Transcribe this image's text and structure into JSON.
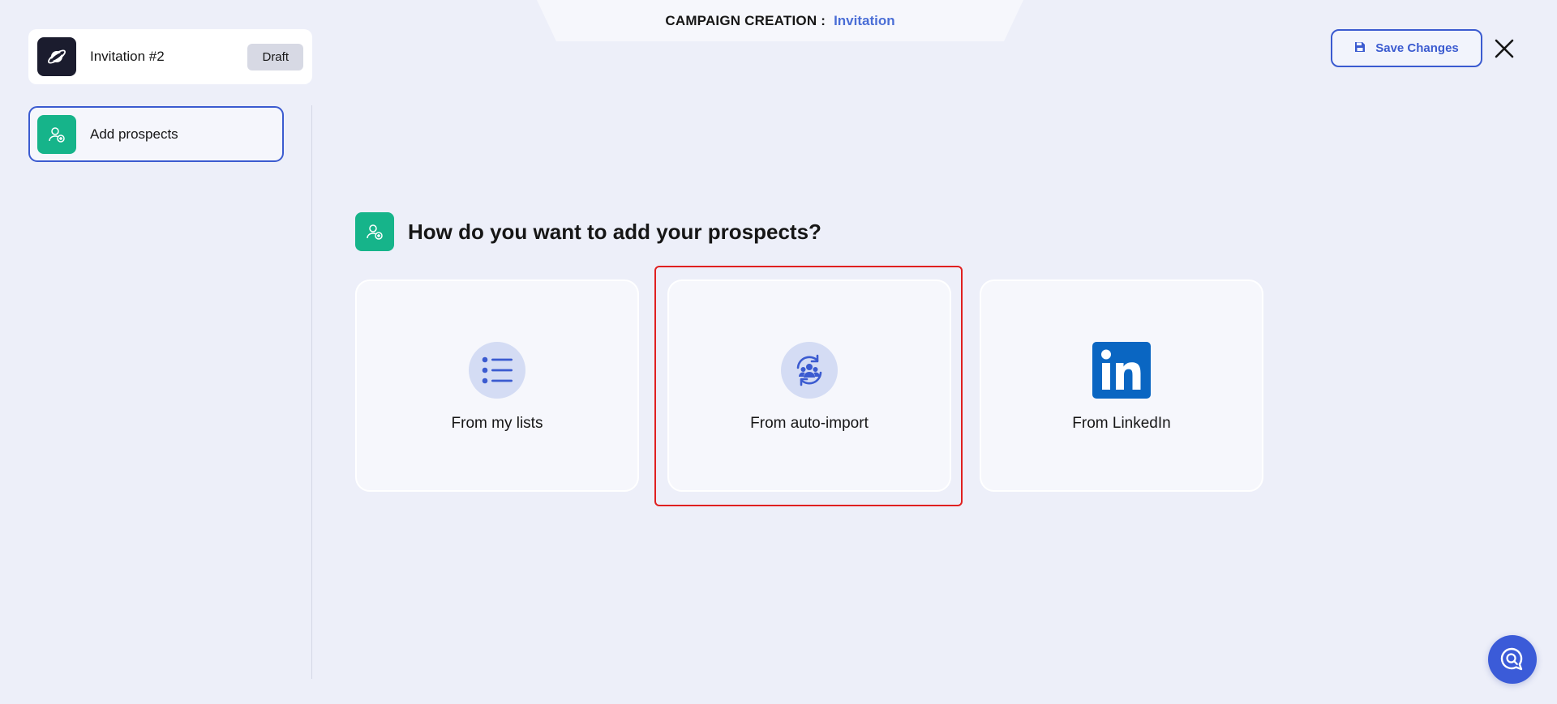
{
  "header": {
    "label": "CAMPAIGN CREATION :",
    "campaign_type": "Invitation"
  },
  "campaign": {
    "name": "Invitation #2",
    "status": "Draft",
    "icon": "planet-icon"
  },
  "sidebar": {
    "steps": [
      {
        "label": "Add prospects",
        "icon": "user-add-icon",
        "active": true
      }
    ]
  },
  "toolbar": {
    "save_label": "Save Changes",
    "save_icon": "floppy-disk-icon",
    "close_icon": "close-icon"
  },
  "main": {
    "question": "How do you want to add your prospects?",
    "options": [
      {
        "label": "From my lists",
        "icon": "list-icon"
      },
      {
        "label": "From auto-import",
        "icon": "auto-import-icon",
        "highlighted": true
      },
      {
        "label": "From LinkedIn",
        "icon": "linkedin-icon"
      }
    ]
  },
  "help": {
    "icon": "chat-search-icon"
  },
  "colors": {
    "accent": "#3b5bd0",
    "green": "#16b48a",
    "linkedin": "#0a66c2",
    "highlight": "#e02020",
    "background": "#edeff9"
  }
}
